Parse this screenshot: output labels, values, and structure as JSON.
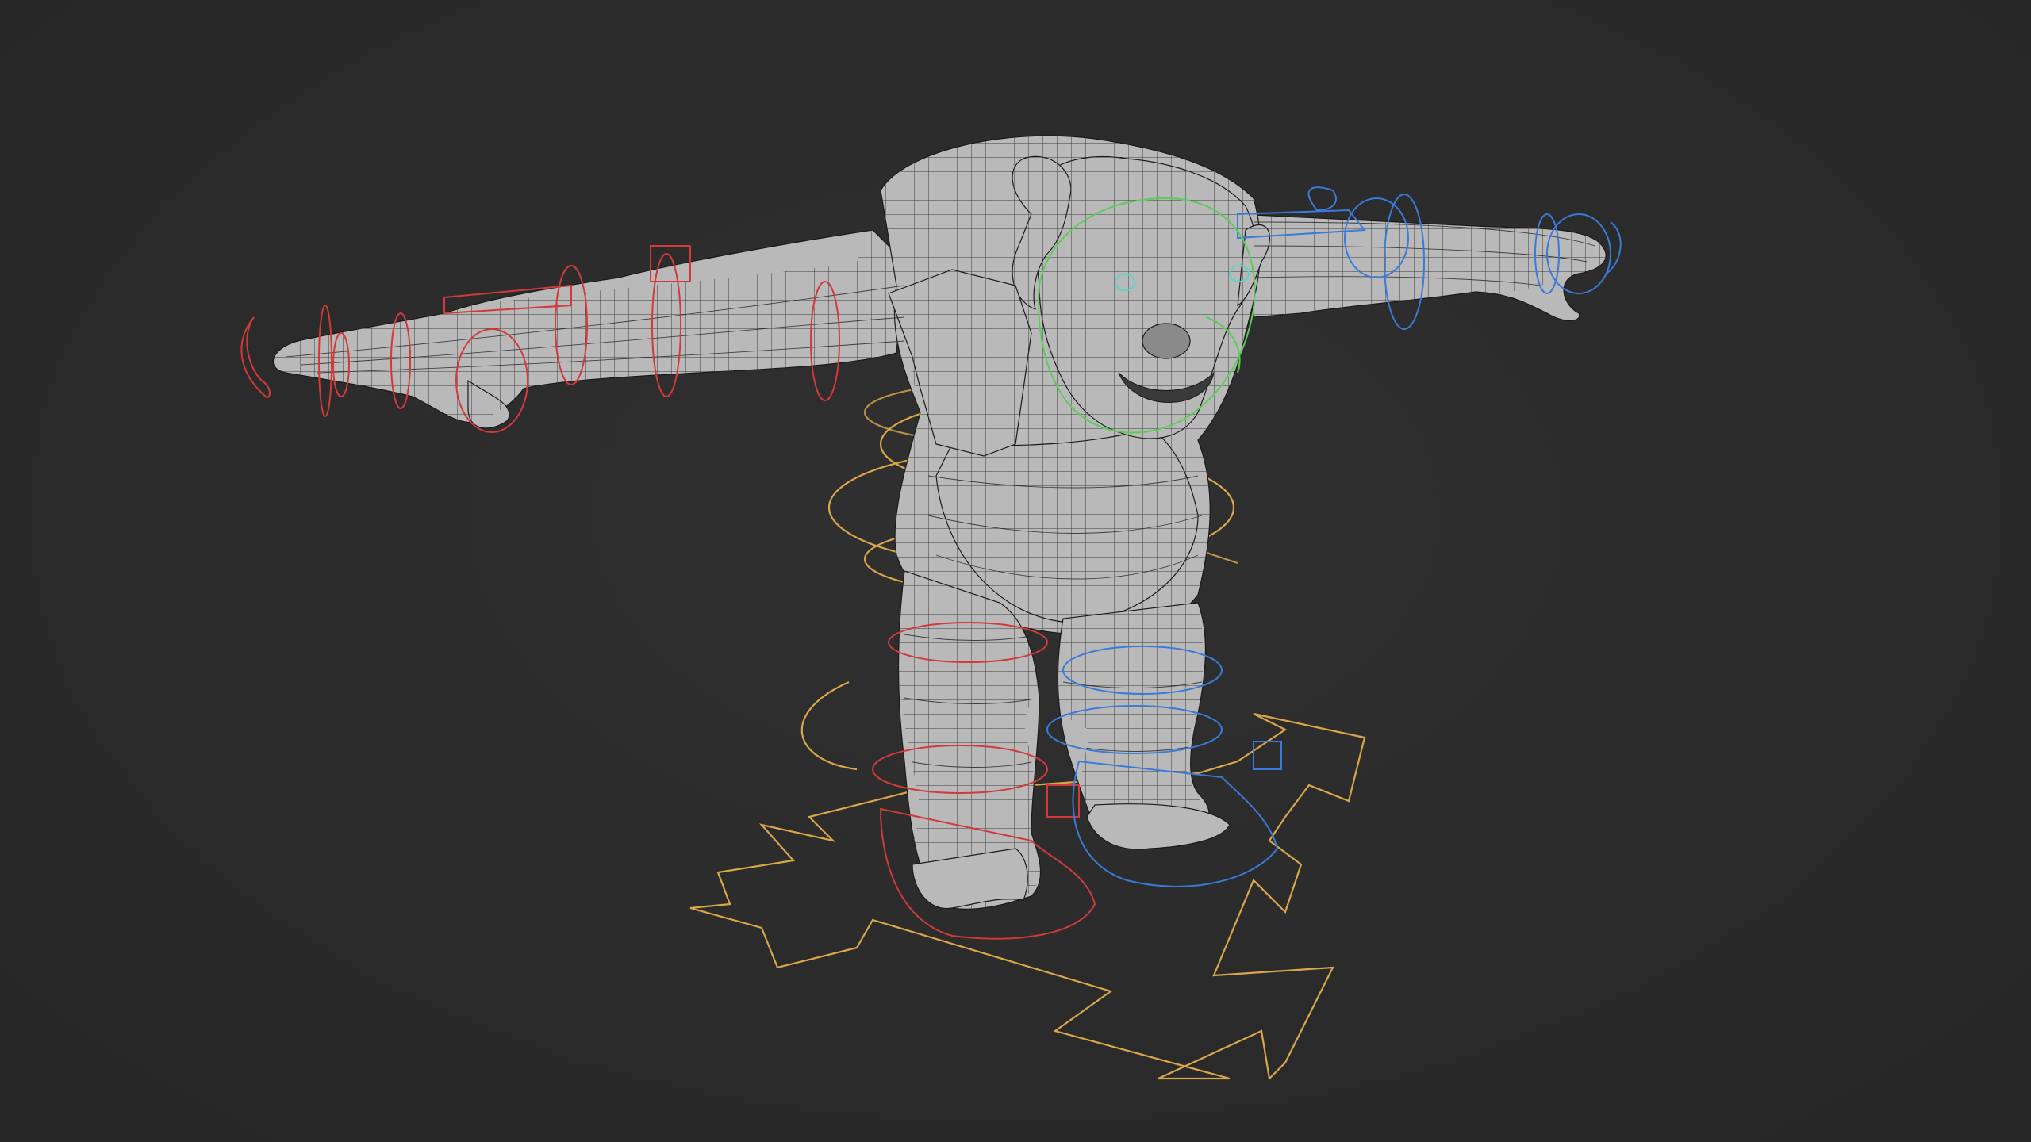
{
  "viewport": {
    "background": "#2b2b2b",
    "object": "character-mesh",
    "display_mode": "solid-with-wireframe"
  },
  "controls": {
    "left_side_color": "#d23a3a",
    "right_side_color": "#3a7ad8",
    "face_color": "#5ccb58",
    "root_color": "#d9a64a",
    "eye_color": "#5fd3c7"
  }
}
